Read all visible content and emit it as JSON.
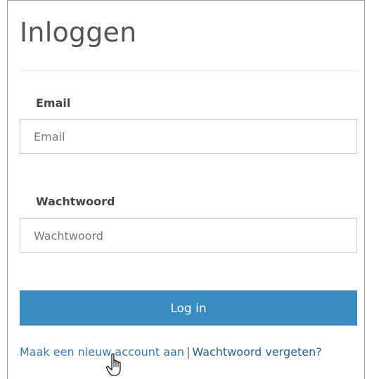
{
  "header": {
    "title": "Inloggen"
  },
  "form": {
    "email": {
      "label": "Email",
      "value": "",
      "placeholder": "Email"
    },
    "password": {
      "label": "Wachtwoord",
      "value": "",
      "placeholder": "Wachtwoord"
    },
    "submit_label": "Log in"
  },
  "links": {
    "register": "Maak een nieuw account aan",
    "separator": "|",
    "forgot": "Wachtwoord vergeten?"
  },
  "colors": {
    "primary_button": "#3a8bbf",
    "link": "#3a7ab3"
  },
  "cursor": {
    "icon": "hand-pointer-icon"
  }
}
